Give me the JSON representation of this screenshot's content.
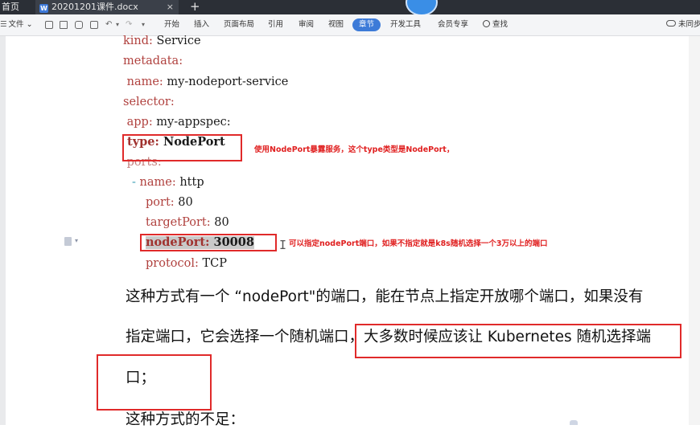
{
  "window": {
    "home_tab": "首页",
    "doc_tab": "20201201课件.docx",
    "doc_tab_close": "×",
    "new_tab": "+"
  },
  "ribbon": {
    "file_menu": "文件",
    "menu_arrow": "⌄",
    "tabs": [
      "开始",
      "插入",
      "页面布局",
      "引用",
      "审阅",
      "视图",
      "章节",
      "开发工具",
      "会员专享"
    ],
    "active_tab": "章节",
    "search": "查找",
    "sync": "未同步"
  },
  "code": {
    "lines": [
      {
        "key": "kind:",
        "val": " Service"
      },
      {
        "key": "metadata:",
        "val": ""
      },
      {
        "key": " name:",
        "val": " my-nodeport-service"
      },
      {
        "key": "selector:",
        "val": ""
      },
      {
        "key": " app:",
        "val": " my-appspec:"
      },
      {
        "key": " type:",
        "val": " NodePort"
      },
      {
        "key": " ports:",
        "val": ""
      },
      {
        "key": "name:",
        "val": " http",
        "dash": "-"
      },
      {
        "key": "port:",
        "val": " 80"
      },
      {
        "key": "targetPort:",
        "val": " 80"
      },
      {
        "key": "nodePort:",
        "val": " 30008"
      },
      {
        "key": "protocol:",
        "val": " TCP"
      }
    ]
  },
  "annotations": {
    "type_note": "使用NodePort暴露服务，这个type类型是NodePort，",
    "nodeport_note": "可以指定nodePort端口，如果不指定就是k8s随机选择一个3万以上的端口"
  },
  "body_text": {
    "para1": "这种方式有一个 “nodePort\"的端口，能在节点上指定开放哪个端口，如果没有",
    "para2": "指定端口，它会选择一个随机端口，大多数时候应该让 Kubernetes 随机选择端",
    "para3": "口；",
    "para4": "这种方式的不足："
  },
  "colors": {
    "annotation_red": "#e02020",
    "active_tab_blue": "#3d7bd8",
    "yaml_key": "#b0413e"
  }
}
